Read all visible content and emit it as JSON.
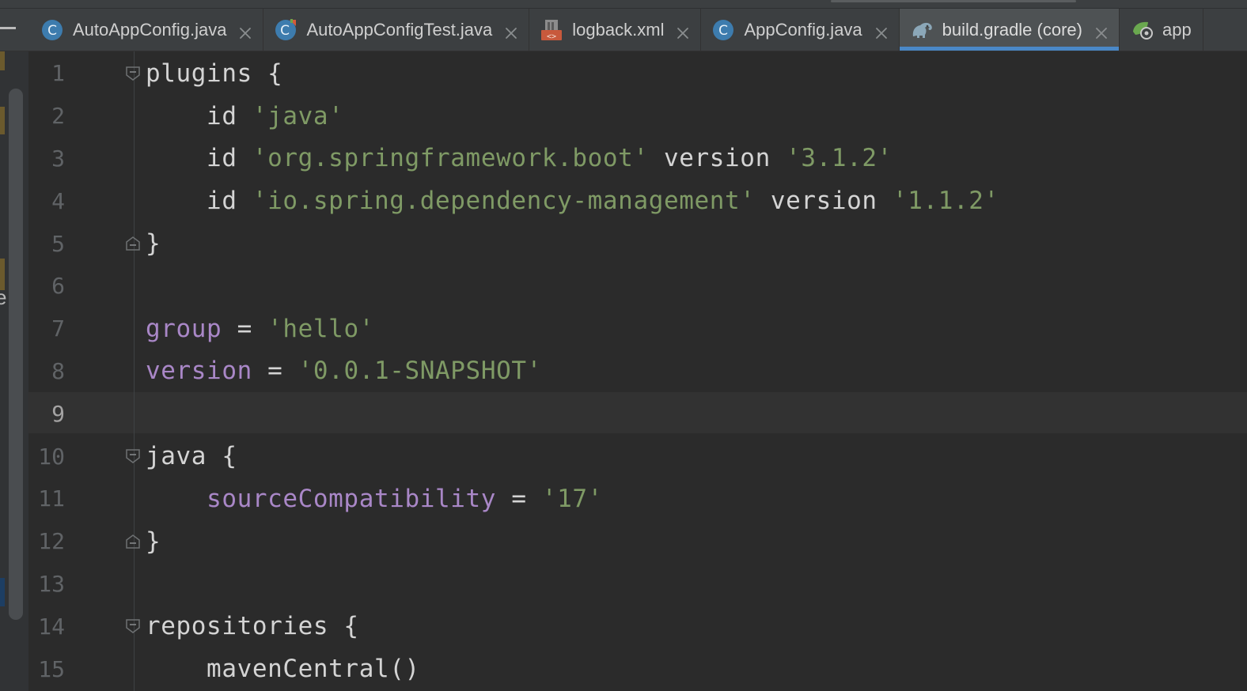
{
  "tabs": [
    {
      "label": "AutoAppConfig.java",
      "icon": "java-class-icon",
      "active": false
    },
    {
      "label": "AutoAppConfigTest.java",
      "icon": "java-test-class-icon",
      "active": false
    },
    {
      "label": "logback.xml",
      "icon": "xml-file-icon",
      "active": false
    },
    {
      "label": "AppConfig.java",
      "icon": "java-class-icon",
      "active": false
    },
    {
      "label": "build.gradle (core)",
      "icon": "gradle-elephant-icon",
      "active": true
    },
    {
      "label": "app",
      "icon": "spring-properties-icon",
      "active": false
    }
  ],
  "editor": {
    "current_line": 9,
    "left_edge_letter": "e",
    "lines": [
      {
        "num": "1",
        "fold": "open",
        "tokens": [
          {
            "t": "plain",
            "v": "plugins {"
          }
        ]
      },
      {
        "num": "2",
        "fold": "",
        "tokens": [
          {
            "t": "plain",
            "v": "    id "
          },
          {
            "t": "str",
            "v": "'java'"
          }
        ]
      },
      {
        "num": "3",
        "fold": "",
        "tokens": [
          {
            "t": "plain",
            "v": "    id "
          },
          {
            "t": "str",
            "v": "'org.springframework.boot'"
          },
          {
            "t": "plain",
            "v": " version "
          },
          {
            "t": "str",
            "v": "'3.1.2'"
          }
        ]
      },
      {
        "num": "4",
        "fold": "",
        "tokens": [
          {
            "t": "plain",
            "v": "    id "
          },
          {
            "t": "str",
            "v": "'io.spring.dependency-management'"
          },
          {
            "t": "plain",
            "v": " version "
          },
          {
            "t": "str",
            "v": "'1.1.2'"
          }
        ]
      },
      {
        "num": "5",
        "fold": "close",
        "tokens": [
          {
            "t": "plain",
            "v": "}"
          }
        ]
      },
      {
        "num": "6",
        "fold": "",
        "tokens": []
      },
      {
        "num": "7",
        "fold": "",
        "tokens": [
          {
            "t": "prop",
            "v": "group"
          },
          {
            "t": "plain",
            "v": " = "
          },
          {
            "t": "str",
            "v": "'hello'"
          }
        ]
      },
      {
        "num": "8",
        "fold": "",
        "tokens": [
          {
            "t": "prop",
            "v": "version"
          },
          {
            "t": "plain",
            "v": " = "
          },
          {
            "t": "str",
            "v": "'0.0.1-SNAPSHOT'"
          }
        ]
      },
      {
        "num": "9",
        "fold": "",
        "tokens": []
      },
      {
        "num": "10",
        "fold": "open",
        "tokens": [
          {
            "t": "plain",
            "v": "java {"
          }
        ]
      },
      {
        "num": "11",
        "fold": "",
        "tokens": [
          {
            "t": "plain",
            "v": "    "
          },
          {
            "t": "prop",
            "v": "sourceCompatibility"
          },
          {
            "t": "plain",
            "v": " = "
          },
          {
            "t": "str",
            "v": "'17'"
          }
        ]
      },
      {
        "num": "12",
        "fold": "close",
        "tokens": [
          {
            "t": "plain",
            "v": "}"
          }
        ]
      },
      {
        "num": "13",
        "fold": "",
        "tokens": []
      },
      {
        "num": "14",
        "fold": "open",
        "tokens": [
          {
            "t": "plain",
            "v": "repositories {"
          }
        ]
      },
      {
        "num": "15",
        "fold": "",
        "tokens": [
          {
            "t": "plain",
            "v": "    mavenCentral()"
          }
        ]
      }
    ]
  },
  "colors": {
    "background": "#2b2b2b",
    "string": "#7f9a65",
    "property": "#a987c7",
    "plain": "#d4d4d4",
    "active_tab_underline": "#4a88c7"
  }
}
